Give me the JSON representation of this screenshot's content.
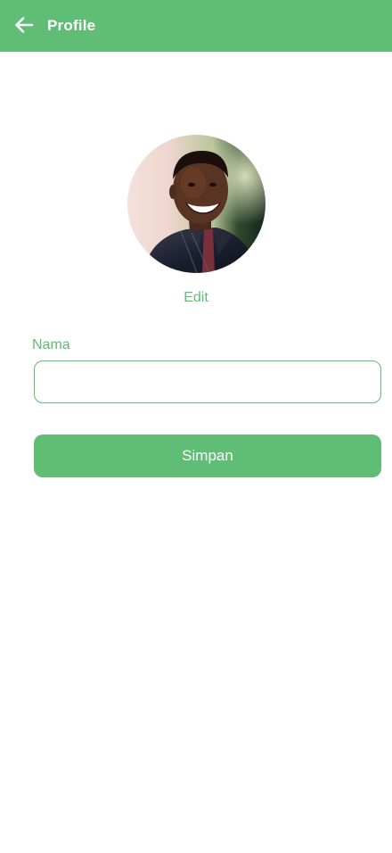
{
  "appbar": {
    "title": "Profile",
    "back_icon": "arrow-left-icon",
    "background_color": "#5fbd75"
  },
  "profile": {
    "avatar_description": "profile-photo",
    "edit_label": "Edit"
  },
  "form": {
    "name_label": "Nama",
    "name_value": "",
    "name_placeholder": "",
    "save_label": "Simpan"
  },
  "colors": {
    "accent": "#5fbd75",
    "text_on_accent": "#ffffff",
    "background": "#ffffff"
  }
}
